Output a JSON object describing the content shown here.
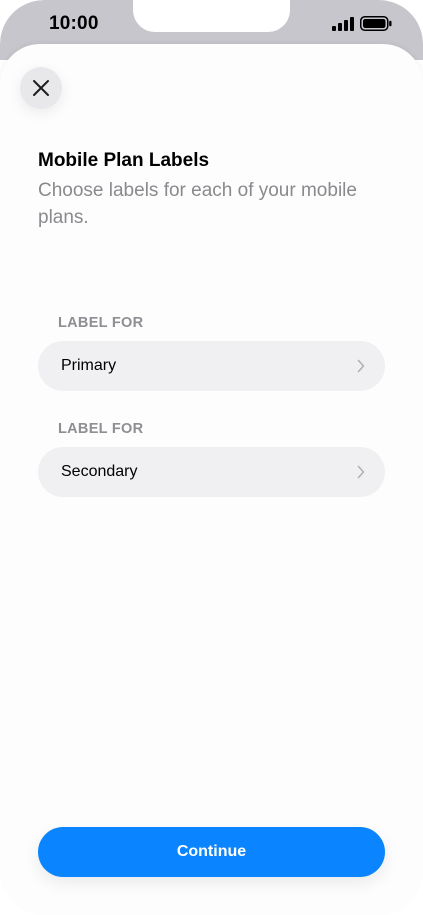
{
  "status_bar": {
    "time": "10:00",
    "signal_icon": "cellular-signal-icon",
    "battery_icon": "battery-icon"
  },
  "sheet": {
    "close_icon": "close-icon",
    "title": "Mobile Plan Labels",
    "subtitle": "Choose labels for each of your mobile plans."
  },
  "sections": [
    {
      "header": "LABEL FOR",
      "value": "Primary"
    },
    {
      "header": "LABEL FOR",
      "value": "Secondary"
    }
  ],
  "footer": {
    "continue_label": "Continue"
  },
  "colors": {
    "accent": "#0a84ff",
    "row_background": "#f0f0f2",
    "secondary_text": "#8e8e93"
  }
}
